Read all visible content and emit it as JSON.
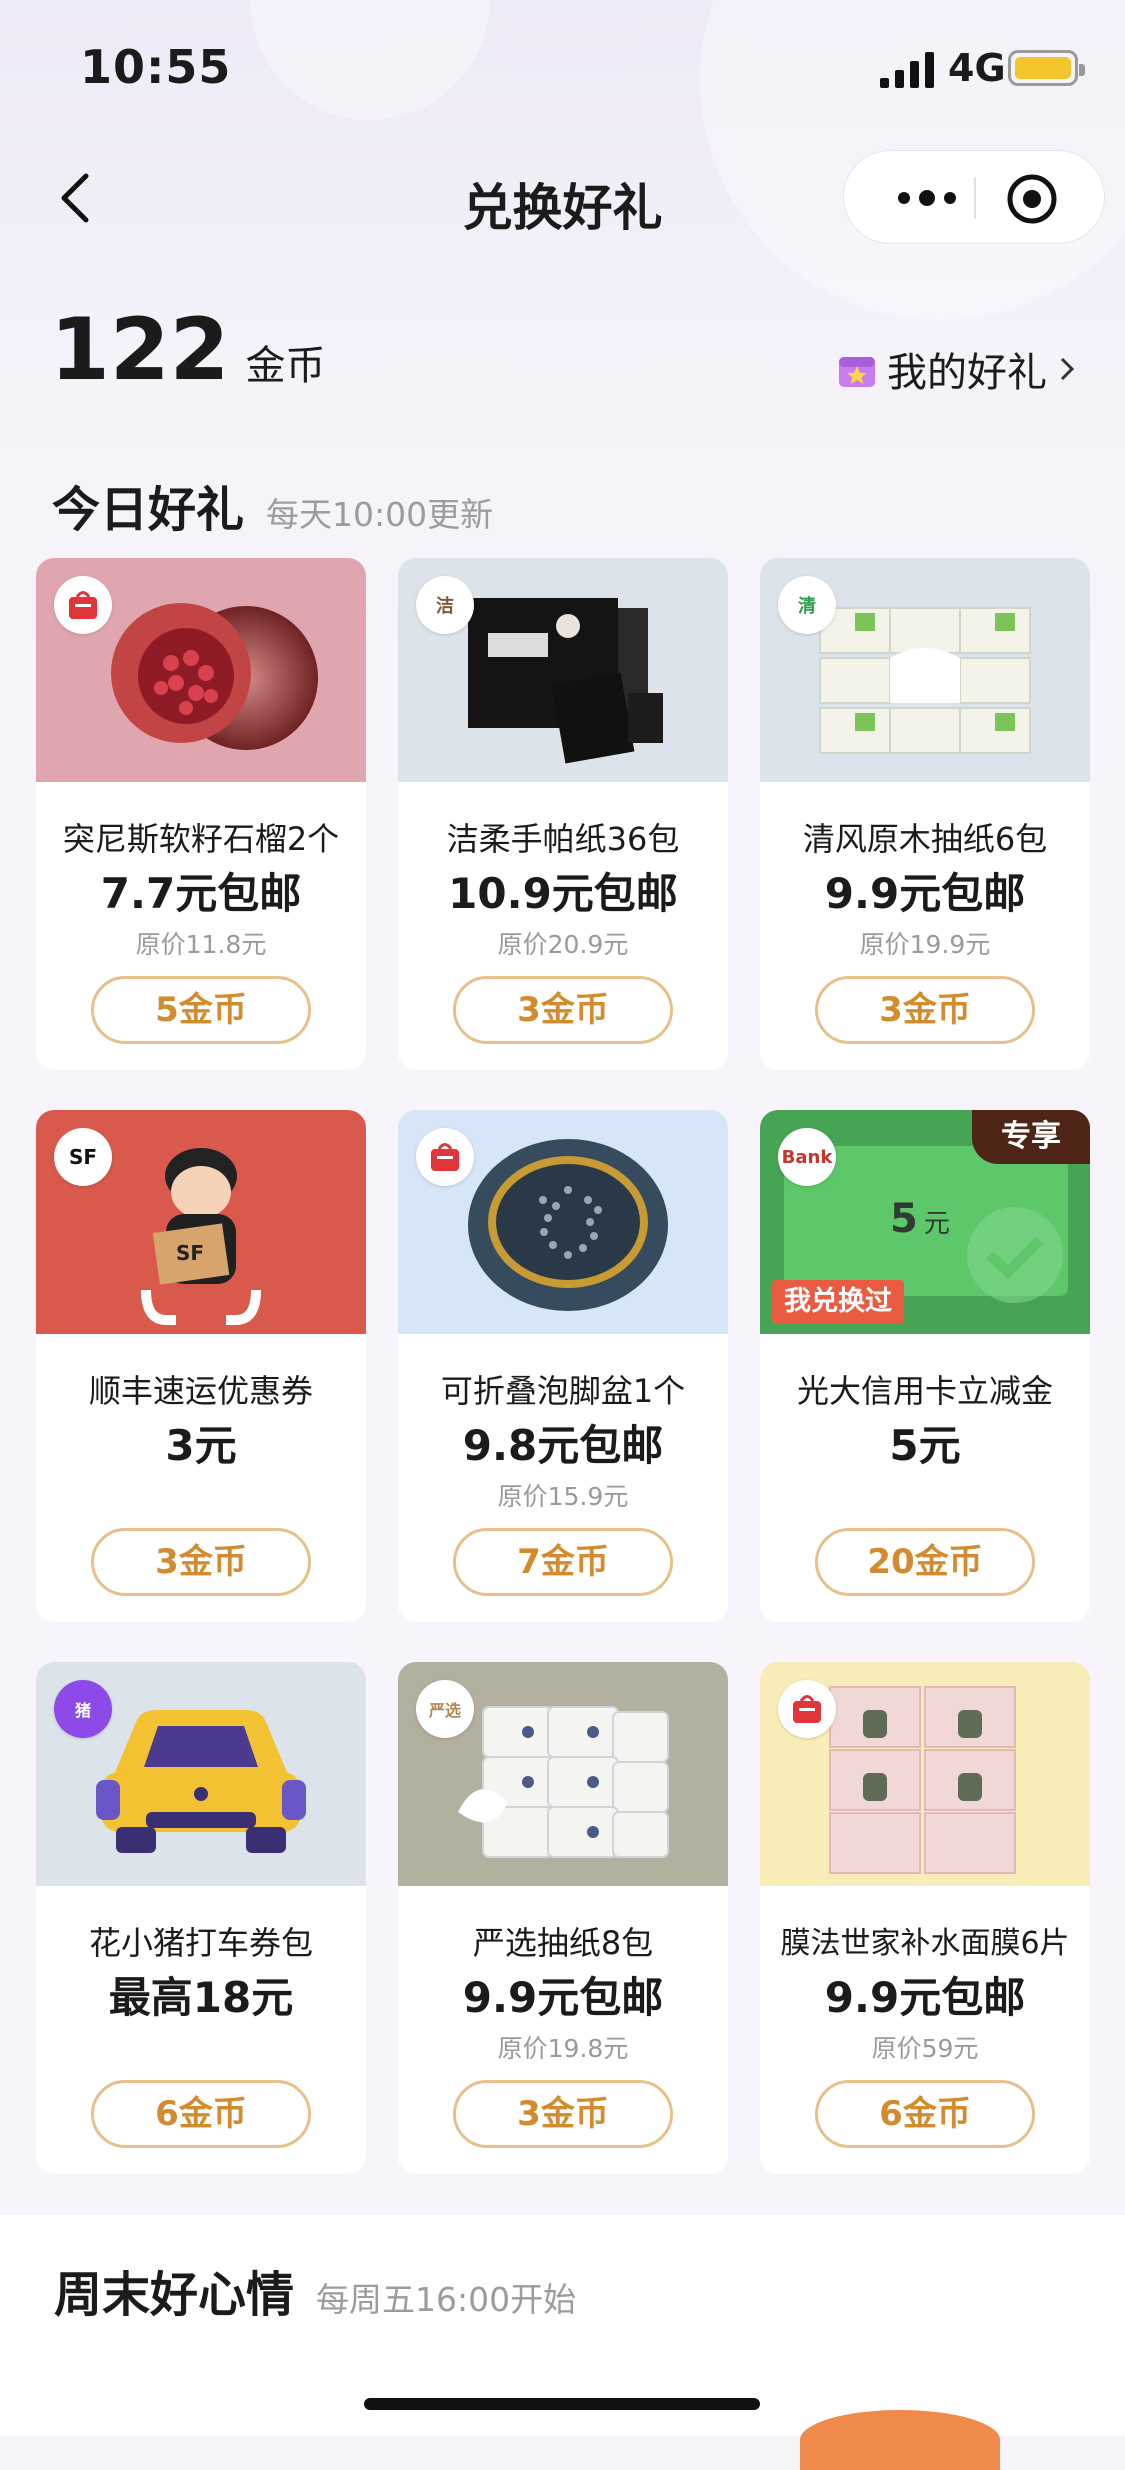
{
  "status_bar": {
    "time": "10:55",
    "network": "4G"
  },
  "nav": {
    "title": "兑换好礼"
  },
  "balance": {
    "amount": "122",
    "unit": "金币",
    "my_gifts": "我的好礼"
  },
  "today": {
    "title": "今日好礼",
    "subtitle": "每天10:00更新"
  },
  "cards": [
    {
      "name": "突尼斯软籽石榴2个",
      "price": "7.7元包邮",
      "original": "原价11.8元",
      "cost": "5金币"
    },
    {
      "name": "洁柔手帕纸36包",
      "price": "10.9元包邮",
      "original": "原价20.9元",
      "cost": "3金币"
    },
    {
      "name": "清风原木抽纸6包",
      "price": "9.9元包邮",
      "original": "原价19.9元",
      "cost": "3金币"
    },
    {
      "name": "顺丰速运优惠券",
      "price": "3元",
      "original": "",
      "cost": "3金币"
    },
    {
      "name": "可折叠泡脚盆1个",
      "price": "9.8元包邮",
      "original": "原价15.9元",
      "cost": "7金币"
    },
    {
      "name": "光大信用卡立减金",
      "price": "5元",
      "original": "",
      "cost": "20金币",
      "ribbon": "专享",
      "tag": "我兑换过",
      "voucher_value": "5",
      "voucher_unit": "元"
    },
    {
      "name": "花小猪打车券包",
      "price": "最高18元",
      "original": "",
      "cost": "6金币"
    },
    {
      "name": "严选抽纸8包",
      "price": "9.9元包邮",
      "original": "原价19.8元",
      "cost": "3金币"
    },
    {
      "name": "膜法世家补水面膜6片",
      "price": "9.9元包邮",
      "original": "原价59元",
      "cost": "6金币"
    }
  ],
  "weekend": {
    "title": "周末好心情",
    "subtitle": "每周五16:00开始"
  },
  "colors": {
    "accent": "#d28c2f",
    "accent_border": "#e7c08b",
    "tag_red": "#e95c41",
    "ribbon_brown": "#4e2517"
  }
}
